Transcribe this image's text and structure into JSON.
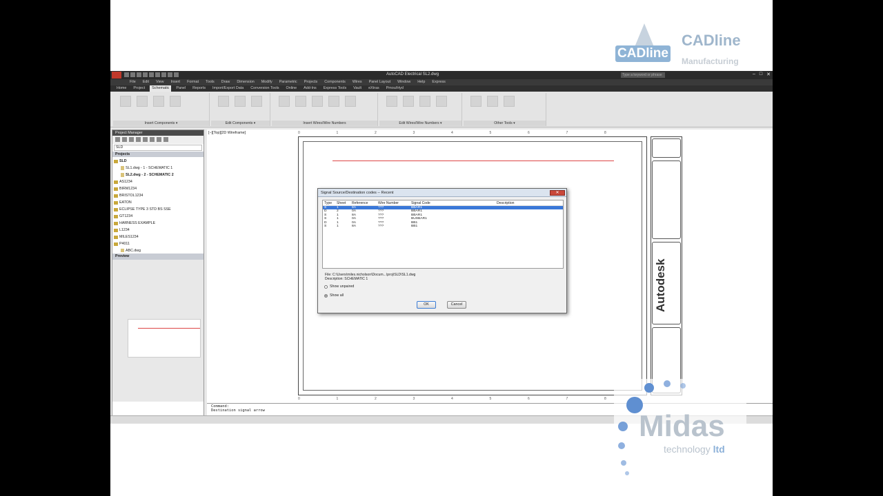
{
  "brand": {
    "cad_box": "CADline",
    "cad_right": "CADline",
    "cad_mfg": "Manufacturing"
  },
  "app": {
    "title": "AutoCAD Electrical    SL2.dwg",
    "search_placeholder": "Type a keyword or phrase",
    "menu": [
      "File",
      "Edit",
      "View",
      "Insert",
      "Format",
      "Tools",
      "Draw",
      "Dimension",
      "Modify",
      "Parametric",
      "Projects",
      "Components",
      "Wires",
      "Panel Layout",
      "Window",
      "Help",
      "Express"
    ],
    "tabs": [
      "Home",
      "Project",
      "Schematic",
      "Panel",
      "Reports",
      "Import/Export Data",
      "Conversion Tools",
      "Online",
      "Add-Ins",
      "Express Tools",
      "Vault",
      "eXtras",
      "Pmou/Hyd"
    ],
    "active_tab": "Schematic",
    "ribbon_groups": [
      "Insert Components ▾",
      "Edit Components ▾",
      "Insert Wires/Wire Numbers",
      "Edit Wires/Wire Numbers ▾",
      "Other Tools ▾"
    ]
  },
  "project_manager": {
    "title": "Project Manager",
    "select_value": "SLD",
    "projects_header": "Projects",
    "items": [
      {
        "label": "SLD",
        "level": 0,
        "bold": true
      },
      {
        "label": "SL1.dwg - 1 - SCHEMATIC 1",
        "level": 1,
        "bold": false
      },
      {
        "label": "SL2.dwg - 2 - SCHEMATIC 2",
        "level": 1,
        "bold": true
      },
      {
        "label": "AS1234",
        "level": 0,
        "bold": false
      },
      {
        "label": "BIRM1234",
        "level": 0,
        "bold": false
      },
      {
        "label": "BRISTOL1234",
        "level": 0,
        "bold": false
      },
      {
        "label": "EATON",
        "level": 0,
        "bold": false
      },
      {
        "label": "ECLIPSE TYPE 3 STD BS SSE",
        "level": 0,
        "bold": false
      },
      {
        "label": "GT1234",
        "level": 0,
        "bold": false
      },
      {
        "label": "HARNESS EXAMPLE",
        "level": 0,
        "bold": false
      },
      {
        "label": "L1234",
        "level": 0,
        "bold": false
      },
      {
        "label": "MILES1234",
        "level": 0,
        "bold": false
      },
      {
        "label": "P4011",
        "level": 0,
        "bold": false
      },
      {
        "label": "ABC.dwg",
        "level": 1,
        "bold": false
      }
    ],
    "preview_label": "Preview"
  },
  "viewport": {
    "label": "[−][Top][2D Wireframe]"
  },
  "ruler": {
    "top": [
      "0",
      "1",
      "2",
      "3",
      "4",
      "5",
      "6",
      "7",
      "8"
    ],
    "bottom": [
      "0",
      "1",
      "2",
      "3",
      "4",
      "5",
      "6",
      "7",
      "8"
    ]
  },
  "titleblock": {
    "logo": "Autodesk"
  },
  "dialog": {
    "title": "Signal Source/Destination codes -- Recent",
    "close": "✕",
    "columns": {
      "type": "Type",
      "sheet": "Sheet",
      "reference": "Reference",
      "wire_number": "Wire Number",
      "signal_code": "Signal Code",
      "description": "Description"
    },
    "rows": [
      {
        "type": "S",
        "sheet": "1",
        "reference": "8A",
        "wire_number": "???",
        "signal_code": "BBAR1",
        "description": "",
        "selected": true
      },
      {
        "type": "D",
        "sheet": "2",
        "reference": "0A",
        "wire_number": "???",
        "signal_code": "BBAR1",
        "description": "",
        "selected": false
      },
      {
        "type": "S",
        "sheet": "1",
        "reference": "8A",
        "wire_number": "???",
        "signal_code": "BBAR1",
        "description": "",
        "selected": false
      },
      {
        "type": "S",
        "sheet": "1",
        "reference": "0A",
        "wire_number": "???",
        "signal_code": "BUSBAR1",
        "description": "",
        "selected": false
      },
      {
        "type": "D",
        "sheet": "1",
        "reference": "0A",
        "wire_number": "???",
        "signal_code": "BB1",
        "description": "",
        "selected": false
      },
      {
        "type": "S",
        "sheet": "1",
        "reference": "8A",
        "wire_number": "???",
        "signal_code": "BB1",
        "description": "",
        "selected": false
      }
    ],
    "file_line": "File: C:\\Users\\miles.nicholson\\Docum...\\proj\\SLD\\SL1.dwg",
    "desc_line": "Description: SCHEMATIC 1",
    "radio_unpaired": "Show unpaired",
    "radio_all": "Show all",
    "ok": "OK",
    "cancel": "Cancel"
  },
  "command": {
    "label": "Command:",
    "text": "Destination signal arrow"
  },
  "midas": {
    "word": "Midas",
    "tech": "technology",
    "ltd": "ltd"
  },
  "colors": {
    "accent_blue": "#3a78d8",
    "wire_red": "#d44444",
    "ribbon_bg": "#e4e4e4",
    "title_dark": "#2b2b2b"
  }
}
